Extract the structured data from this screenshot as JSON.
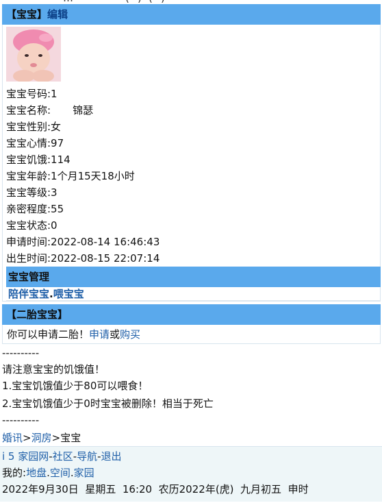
{
  "top_clip": {
    "a": "…",
    "b": "(",
    "c": ")",
    "d": "(",
    "e": ")"
  },
  "header": {
    "title": "【宝宝】",
    "edit_link": "编辑"
  },
  "profile": {
    "number": "宝宝号码:1",
    "name_label": "宝宝名称:",
    "name_value": "锦瑟",
    "gender": "宝宝性别:女",
    "mood": "宝宝心情:97",
    "hunger": "宝宝饥饿:114",
    "age": "宝宝年龄:1个月15天18小时",
    "level": "宝宝等级:3",
    "intimacy": "亲密程度:55",
    "status": "宝宝状态:0",
    "apply_time": "申请时间:2022-08-14 16:46:43",
    "birth_time": "出生时间:2022-08-15 22:07:14"
  },
  "manage": {
    "title": "宝宝管理",
    "accompany": "陪伴宝宝",
    "dot": ".",
    "feed": "喂宝宝"
  },
  "second": {
    "title": "【二胎宝宝】",
    "prompt": "你可以申请二胎！",
    "apply": "申请",
    "or": "或",
    "buy": "购买"
  },
  "notes": {
    "divider1": "----------",
    "line1": "请注意宝宝的饥饿值！",
    "line2": "1.宝宝饥饿值少于80可以喂食！",
    "line3": "2.宝宝饥饿值少于0时宝宝被删除！相当于死亡",
    "divider2": "----------"
  },
  "breadcrumb": {
    "item1": "婚讯",
    "sep1": ">",
    "item2": "洞房",
    "sep2": ">",
    "current": "宝宝"
  },
  "footer": {
    "site": "i 5 家园网",
    "dash1": "-",
    "community": "社区",
    "dash2": "-",
    "nav": "导航",
    "dash3": "-",
    "logout": "退出",
    "mine_label": "我的:",
    "land": "地盘",
    "dot1": ".",
    "space": "空间",
    "dot2": ".",
    "home": "家园",
    "datetime": "2022年9月30日  星期五  16:20  农历2022年(虎)  九月初五  申时"
  }
}
